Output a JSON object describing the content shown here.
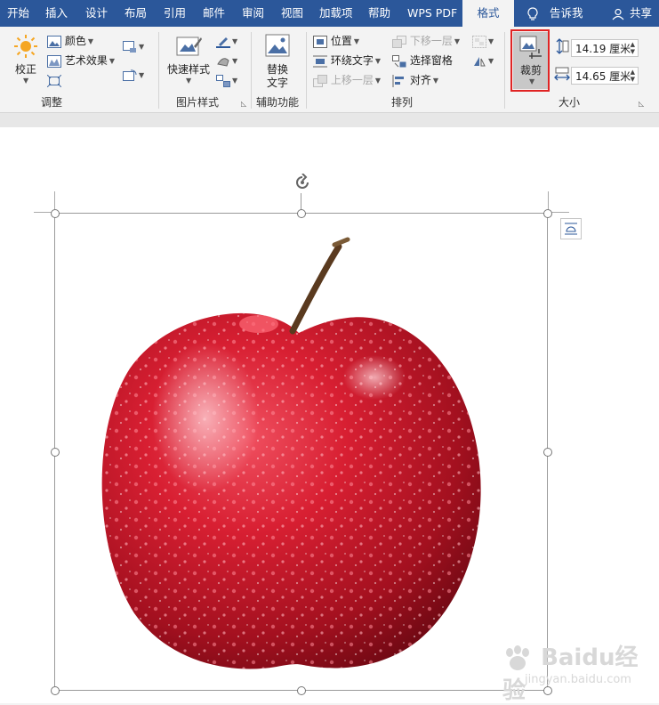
{
  "tabs": [
    {
      "label": "开始",
      "active": false
    },
    {
      "label": "插入",
      "active": false
    },
    {
      "label": "设计",
      "active": false
    },
    {
      "label": "布局",
      "active": false
    },
    {
      "label": "引用",
      "active": false
    },
    {
      "label": "邮件",
      "active": false
    },
    {
      "label": "审阅",
      "active": false
    },
    {
      "label": "视图",
      "active": false
    },
    {
      "label": "加载项",
      "active": false
    },
    {
      "label": "帮助",
      "active": false
    },
    {
      "label": "WPS PDF",
      "active": false
    },
    {
      "label": "格式",
      "active": true
    }
  ],
  "tell_me": "告诉我",
  "share": "共享",
  "groups": {
    "adjust": {
      "label": "调整",
      "correct": "校正",
      "color": "颜色",
      "artistic": "艺术效果"
    },
    "picture_styles": {
      "label": "图片样式",
      "quick_styles": "快速样式"
    },
    "accessibility": {
      "label": "辅助功能",
      "alt_text_line1": "替换",
      "alt_text_line2": "文字"
    },
    "arrange": {
      "label": "排列",
      "position": "位置",
      "wrap_text": "环绕文字",
      "bring_forward": "上移一层",
      "send_backward": "下移一层",
      "selection_pane": "选择窗格",
      "align": "对齐"
    },
    "size": {
      "label": "大小",
      "crop": "裁剪",
      "height": "14.19 厘米",
      "width": "14.65 厘米"
    }
  },
  "watermark": {
    "brand": "Baidu经验",
    "url": "jingyan.baidu.com"
  },
  "colors": {
    "ribbon_blue": "#2b579a",
    "highlight_red": "#e02424",
    "apple_red": "#c4162a"
  }
}
